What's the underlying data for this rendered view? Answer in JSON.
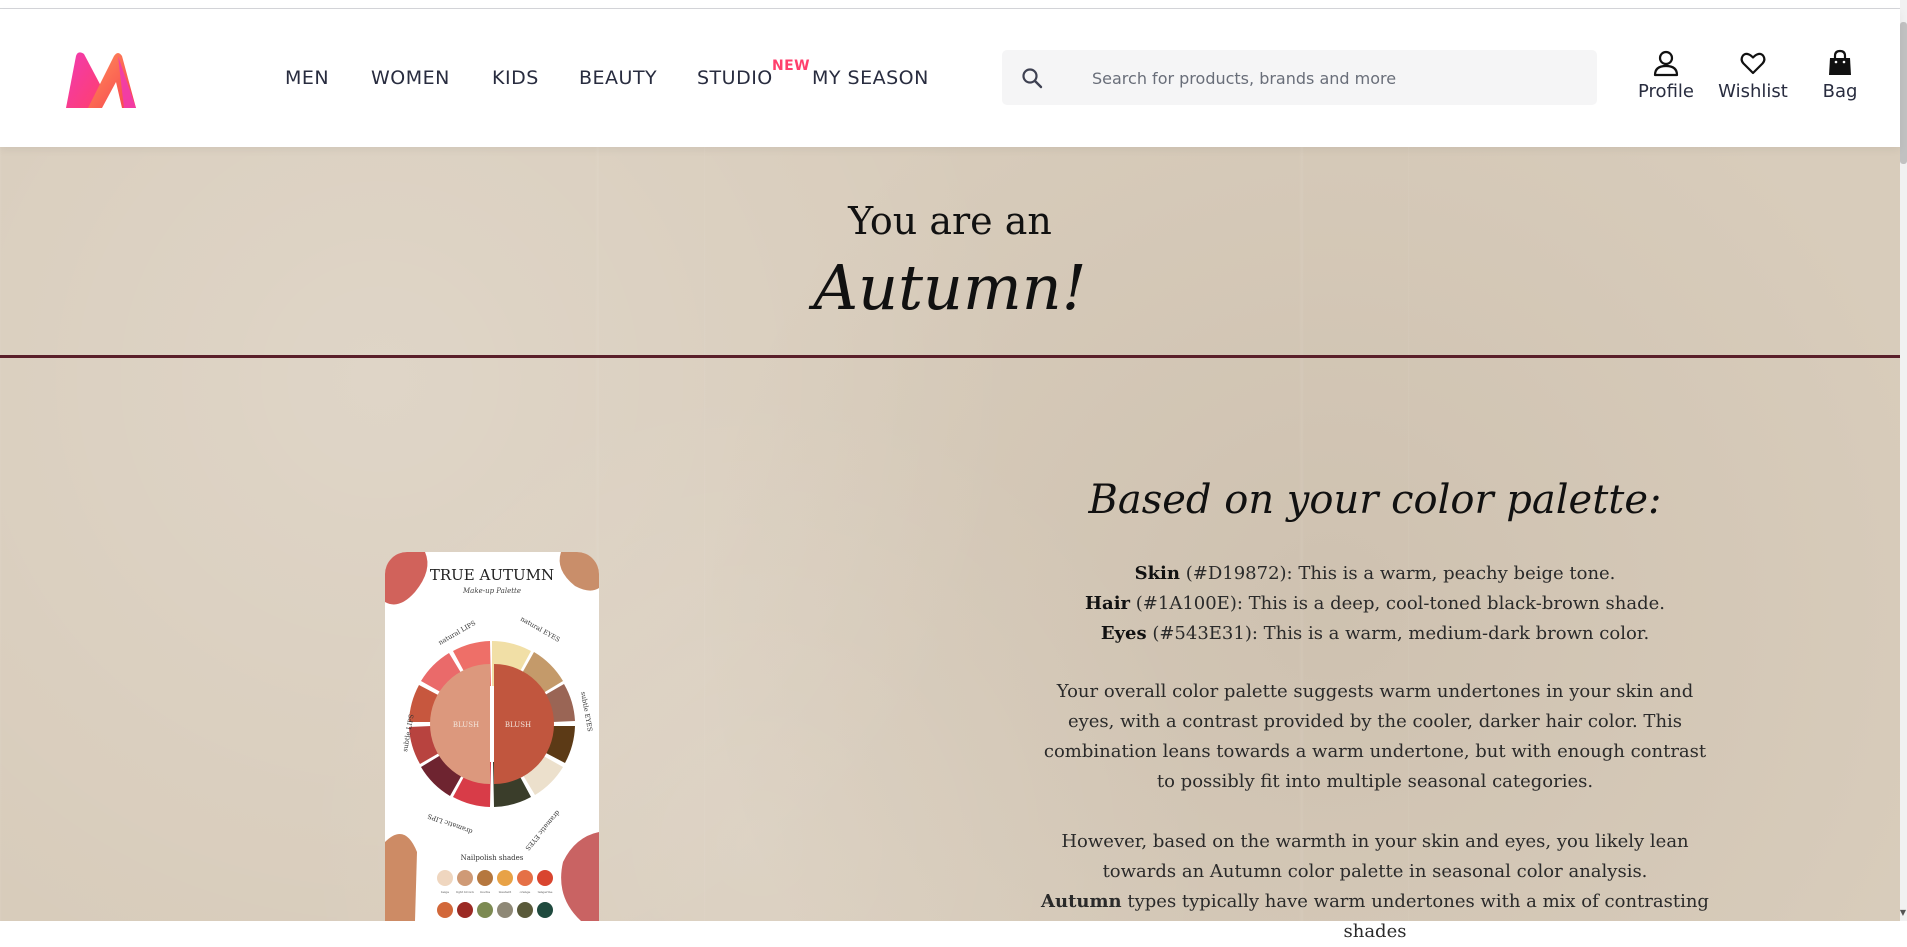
{
  "header": {
    "logo_name": "myntra-logo",
    "nav": [
      {
        "label": "MEN"
      },
      {
        "label": "WOMEN"
      },
      {
        "label": "KIDS"
      },
      {
        "label": "BEAUTY"
      },
      {
        "label": "STUDIO"
      },
      {
        "label": "MY SEASON"
      }
    ],
    "studio_badge": "NEW",
    "search": {
      "placeholder": "Search for products, brands and more",
      "icon": "search-icon"
    },
    "actions": [
      {
        "label": "Profile",
        "icon": "profile-icon"
      },
      {
        "label": "Wishlist",
        "icon": "heart-icon"
      },
      {
        "label": "Bag",
        "icon": "bag-icon"
      }
    ]
  },
  "hero": {
    "line1": "You are an",
    "season": "Autumn!"
  },
  "palette_image": {
    "title": "TRUE AUTUMN",
    "subtitle": "Make-up Palette",
    "wheel_labels": [
      "natural LIPS",
      "natural EYES",
      "subtle LIPS",
      "subtle EYES",
      "dramatic LIPS",
      "dramatic EYES"
    ],
    "center_labels": [
      "BLUSH",
      "BLUSH"
    ],
    "nail_heading": "Nailpolish shades",
    "nail_names": [
      "beige",
      "light brown",
      "mocha",
      "mustard",
      "orange",
      "tangerine"
    ]
  },
  "analysis": {
    "heading": "Based on your color palette:",
    "attributes": [
      {
        "name": "Skin",
        "hex": "(#D19872)",
        "desc": ": This is a warm, peachy beige tone."
      },
      {
        "name": "Hair",
        "hex": "(#1A100E)",
        "desc": ": This is a deep, cool-toned black-brown shade."
      },
      {
        "name": "Eyes",
        "hex": "(#543E31)",
        "desc": ": This is a warm, medium-dark brown color."
      }
    ],
    "paragraph1": "Your overall color palette suggests warm undertones in your skin and eyes, with a contrast provided by the cooler, darker hair color. This combination leans towards a warm undertone, but with enough contrast to possibly fit into multiple seasonal categories.",
    "paragraph2": "However, based on the warmth in your skin and eyes, you likely lean towards an Autumn color palette in seasonal color analysis.",
    "paragraph3_bold": "Autumn",
    "paragraph3_rest": " types typically have warm undertones with a mix of contrasting shades"
  },
  "colors": {
    "brand_pink": "#ff3f6c",
    "divider": "#5a1f2a",
    "background": "#d8ccbb"
  }
}
